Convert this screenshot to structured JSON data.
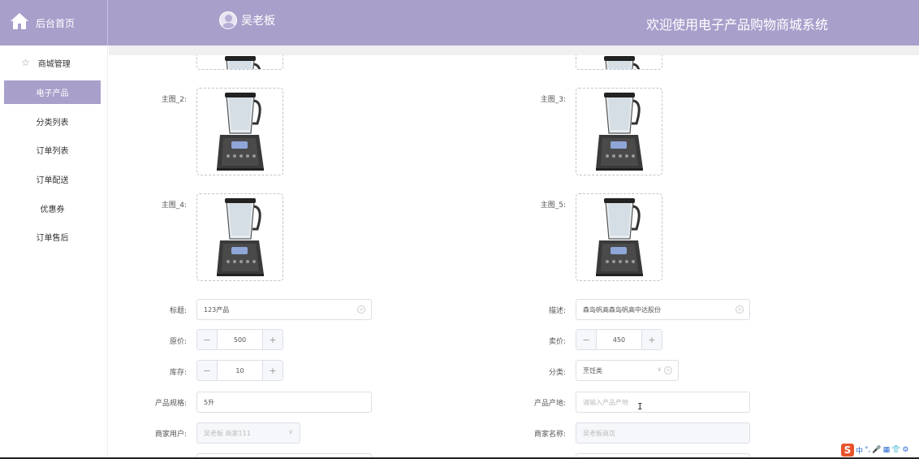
{
  "header": {
    "home_label": "后台首页",
    "user_name": "吴老板",
    "welcome": "欢迎使用电子产品购物商城系统"
  },
  "sidebar": {
    "group_label": "商城管理",
    "items": [
      {
        "label": "电子产品",
        "active": true
      },
      {
        "label": "分类列表"
      },
      {
        "label": "订单列表"
      },
      {
        "label": "订单配送"
      },
      {
        "label": "优惠券"
      },
      {
        "label": "订单售后"
      }
    ]
  },
  "form": {
    "image_labels": {
      "img2": "主图_2:",
      "img3": "主图_3:",
      "img4": "主图_4:",
      "img5": "主图_5:"
    },
    "title": {
      "label": "标题:",
      "value": "123产品"
    },
    "description": {
      "label": "描述:",
      "value": "森岛帆高森岛帆高中达股份"
    },
    "original_price": {
      "label": "原价:",
      "value": "500"
    },
    "sale_price": {
      "label": "卖价:",
      "value": "450"
    },
    "stock": {
      "label": "库存:",
      "value": "10"
    },
    "category": {
      "label": "分类:",
      "value": "烹饪类"
    },
    "spec": {
      "label": "产品规格:",
      "value": "5升"
    },
    "origin": {
      "label": "产品产地:",
      "placeholder": "请输入产品产地"
    },
    "merchant_user": {
      "label": "商家用户:",
      "value": "吴老板 商家111"
    },
    "merchant_name": {
      "label": "商家名称:",
      "value": "吴老板商店"
    }
  },
  "stepper": {
    "minus": "−",
    "plus": "+"
  },
  "tray": {
    "items": [
      "中",
      "°,",
      "🎤",
      "▦",
      "👕",
      "⚙"
    ]
  },
  "colors": {
    "accent": "#a99fcb"
  },
  "icons": {
    "home": "home-icon",
    "user": "avatar-icon",
    "star": "star-icon"
  }
}
